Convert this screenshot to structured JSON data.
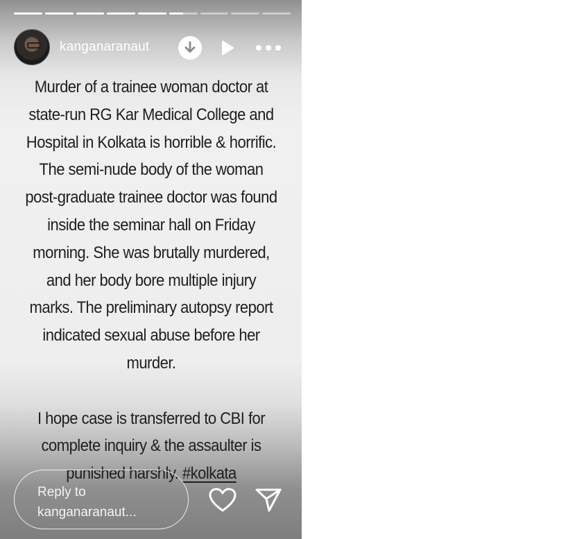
{
  "story": {
    "progress_segments": [
      1,
      1,
      1,
      1,
      1,
      0.5,
      0,
      0,
      0
    ],
    "progress_color": "#ffffff",
    "username": "kanganaranaut",
    "icons": {
      "download": "download-icon",
      "play": "play-icon",
      "more": "more-icon",
      "heart": "heart-icon",
      "send": "send-icon"
    },
    "caption": {
      "paragraph1": "Murder of a trainee woman doctor at state-run RG Kar Medical College and Hospital in Kolkata is horrible & horrific. The semi-nude body of the woman post-graduate trainee doctor was found inside the seminar hall on Friday morning. She was brutally murdered, and her body bore multiple injury marks. The preliminary autopsy report indicated sexual abuse before her murder.",
      "paragraph2_text": "I hope case is transferred to CBI for complete inquiry & the assaulter is punished harshly. ",
      "paragraph2_hashtag": "#kolkata"
    },
    "reply_placeholder_line1": "Reply to",
    "reply_placeholder_line2": "kanganaranaut..."
  }
}
